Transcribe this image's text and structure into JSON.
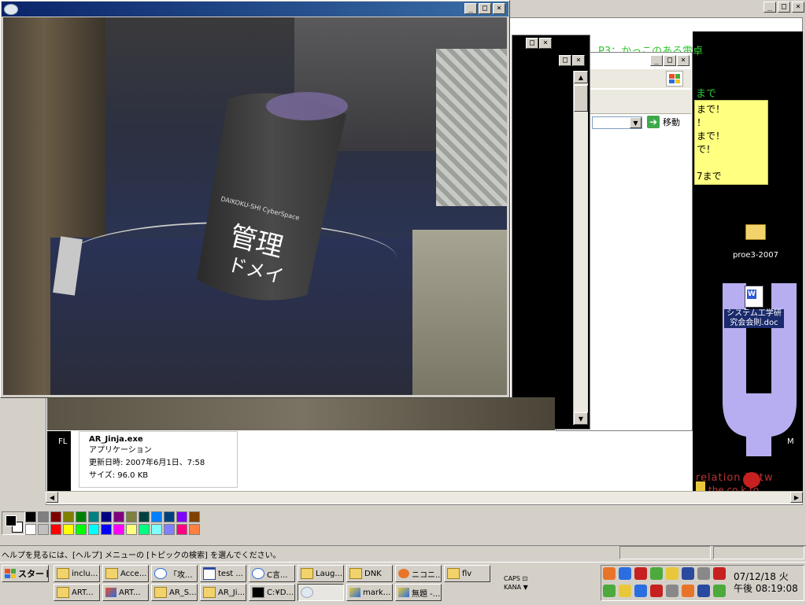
{
  "outer_window": {
    "title_buttons": [
      "_",
      "□",
      "×"
    ]
  },
  "black_desktop": {
    "header_text": "P3：かっこのある電卓",
    "green_line": "まで",
    "sticky_lines": [
      "まで！",
      "！",
      "まで！",
      "で！",
      "",
      "7まで"
    ],
    "folder_label": "proe3-2007",
    "doc_label_1": "システム工学研",
    "doc_label_2": "究会会則.doc",
    "bottom_text": "relation betw",
    "bottom_text2": "the co  k to",
    "side_letter_m": "M",
    "side_letter_f": "FL"
  },
  "explorer": {
    "go_label": "移動",
    "file_info": {
      "name": "AR_Jinja.exe",
      "type": "アプリケーション",
      "modified": "更新日時: 2007年6月1日、7:58",
      "size": "サイズ: 96.0 KB"
    }
  },
  "ar_window": {
    "title_buttons": [
      "_",
      "□",
      "×"
    ],
    "cylinder_text_small": "DAIKOKU-SHI CyberSpace",
    "cylinder_text_big1": "管理",
    "cylinder_text_big2": "ドメイ"
  },
  "paint": {
    "status_text": "ヘルプを見るには、[ヘルプ] メニューの [トピックの検索] を選んでください。",
    "palette": [
      "#000000",
      "#808080",
      "#800000",
      "#808000",
      "#008000",
      "#008080",
      "#000080",
      "#800080",
      "#808040",
      "#004040",
      "#0080ff",
      "#004080",
      "#8000ff",
      "#804000",
      "#ffffff",
      "#c0c0c0",
      "#ff0000",
      "#ffff00",
      "#00ff00",
      "#00ffff",
      "#0000ff",
      "#ff00ff",
      "#ffff80",
      "#00ff80",
      "#80ffff",
      "#8080ff",
      "#ff0080",
      "#ff8040"
    ]
  },
  "taskbar": {
    "start_label": "スタート",
    "row1": [
      {
        "label": "inclu...",
        "icon": "folder-icon"
      },
      {
        "label": "Acce...",
        "icon": "folder-icon"
      },
      {
        "label": "「攻...",
        "icon": "ie-icon"
      },
      {
        "label": "test ...",
        "icon": "window-icon"
      },
      {
        "label": "C言...",
        "icon": "ie-icon"
      },
      {
        "label": "Laug...",
        "icon": "folder-icon"
      },
      {
        "label": "DNK",
        "icon": "folder-icon"
      },
      {
        "label": "ニコニ...",
        "icon": "firefox-icon"
      },
      {
        "label": "flv",
        "icon": "folder-icon"
      }
    ],
    "row2": [
      {
        "label": "ART...",
        "icon": "folder-icon"
      },
      {
        "label": "ART...",
        "icon": "app-icon"
      },
      {
        "label": "AR_S...",
        "icon": "folder-icon"
      },
      {
        "label": "AR_Ji...",
        "icon": "folder-icon"
      },
      {
        "label": "C:¥D...",
        "icon": "cmd-icon"
      },
      {
        "label": "",
        "icon": "ar-icon"
      },
      {
        "label": "mark...",
        "icon": "paint-icon"
      },
      {
        "label": "無題 -...",
        "icon": "paint-icon"
      }
    ],
    "ime_caps": "CAPS",
    "ime_kana": "KANA",
    "clock_date": "07/12/18 火",
    "clock_time": "午後 08:19:08"
  }
}
